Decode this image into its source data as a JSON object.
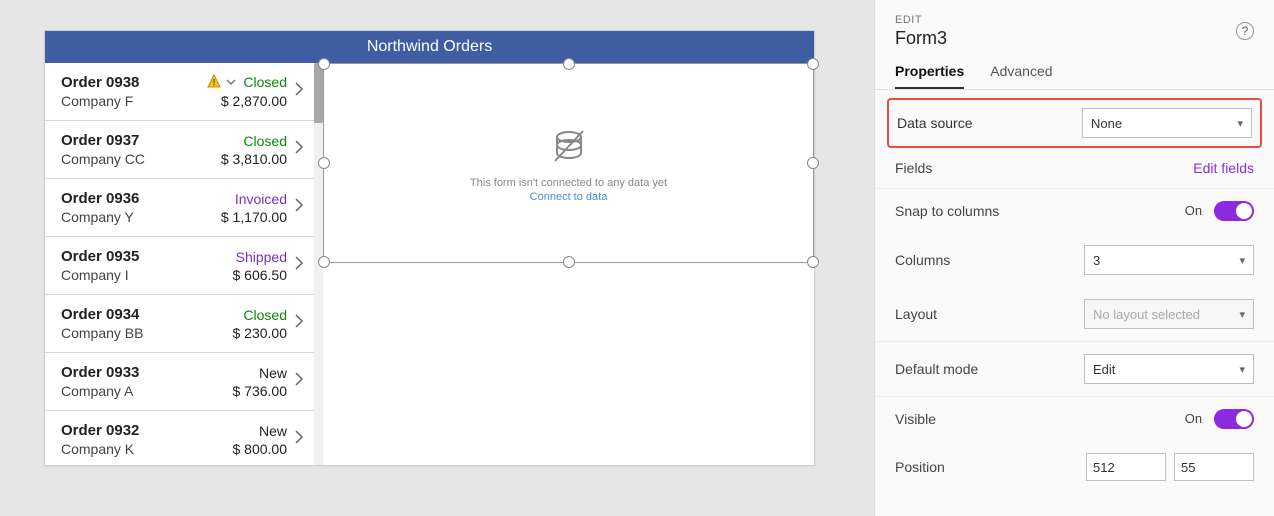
{
  "canvas": {
    "title": "Northwind Orders",
    "form_empty_msg": "This form isn't connected to any data yet",
    "form_connect_link": "Connect to data"
  },
  "orders": [
    {
      "num": "Order 0938",
      "company": "Company F",
      "status": "Closed",
      "status_cls": "status-closed",
      "amount": "$ 2,870.00",
      "warn": true
    },
    {
      "num": "Order 0937",
      "company": "Company CC",
      "status": "Closed",
      "status_cls": "status-closed",
      "amount": "$ 3,810.00",
      "warn": false
    },
    {
      "num": "Order 0936",
      "company": "Company Y",
      "status": "Invoiced",
      "status_cls": "status-invoiced",
      "amount": "$ 1,170.00",
      "warn": false
    },
    {
      "num": "Order 0935",
      "company": "Company I",
      "status": "Shipped",
      "status_cls": "status-shipped",
      "amount": "$ 606.50",
      "warn": false
    },
    {
      "num": "Order 0934",
      "company": "Company BB",
      "status": "Closed",
      "status_cls": "status-closed",
      "amount": "$ 230.00",
      "warn": false
    },
    {
      "num": "Order 0933",
      "company": "Company A",
      "status": "New",
      "status_cls": "status-new",
      "amount": "$ 736.00",
      "warn": false
    },
    {
      "num": "Order 0932",
      "company": "Company K",
      "status": "New",
      "status_cls": "status-new",
      "amount": "$ 800.00",
      "warn": false
    }
  ],
  "panel": {
    "edit_label": "EDIT",
    "name": "Form3",
    "tabs": {
      "properties": "Properties",
      "advanced": "Advanced"
    },
    "data_source": {
      "label": "Data source",
      "value": "None"
    },
    "fields": {
      "label": "Fields",
      "link": "Edit fields"
    },
    "snap": {
      "label": "Snap to columns",
      "state": "On"
    },
    "columns": {
      "label": "Columns",
      "value": "3"
    },
    "layout": {
      "label": "Layout",
      "value": "No layout selected"
    },
    "default_mode": {
      "label": "Default mode",
      "value": "Edit"
    },
    "visible": {
      "label": "Visible",
      "state": "On"
    },
    "position": {
      "label": "Position",
      "x": "512",
      "y": "55"
    }
  }
}
